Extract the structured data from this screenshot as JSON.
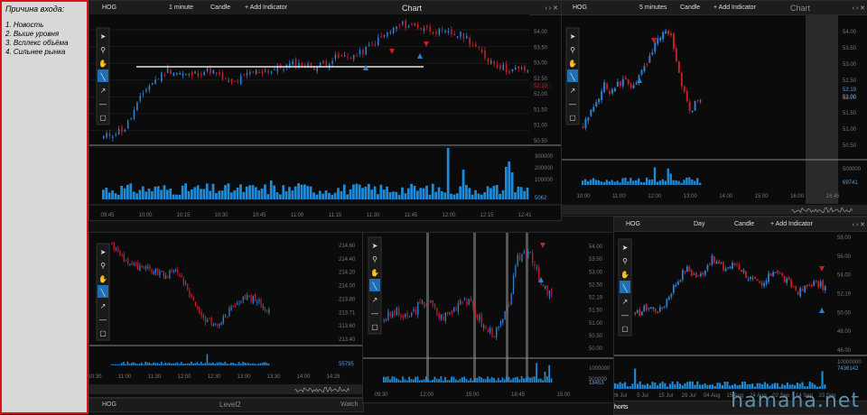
{
  "note": {
    "title": "Причина входа:",
    "items": [
      "1. Новость",
      "2. Выше уровня",
      "3. Всплекс объёма",
      "4. Сильнее рынка"
    ]
  },
  "colors": {
    "up": "#2f7fd0",
    "down": "#c0202a",
    "level": "#e8e8e8",
    "volume": "#1e8ad8",
    "axis": "#777777",
    "grid": "#1b1b1b"
  },
  "icons": {
    "tools": [
      "cursor-icon",
      "zoom-icon",
      "hand-icon",
      "line-icon",
      "arrow-icon",
      "hline-icon",
      "rect-icon"
    ],
    "window": [
      "left-arrow-icon",
      "right-arrow-icon",
      "close-icon"
    ]
  },
  "main": {
    "symbol": "HOG",
    "interval": "1 minute",
    "type": "Candle",
    "add": "+ Add Indicator",
    "title": "Chart",
    "y_labels": [
      "54.00",
      "53.50",
      "53.00",
      "52.50",
      "52.00",
      "51.50",
      "51.00",
      "50.50"
    ],
    "price_tag": "52.19",
    "vol_labels": [
      "300000",
      "200000",
      "100000"
    ],
    "vol_tag": "5062",
    "x_labels": [
      "09:45",
      "10:00",
      "10:15",
      "10:30",
      "10:45",
      "11:00",
      "11:15",
      "11:30",
      "11:45",
      "12:00",
      "12:15",
      "12:41"
    ]
  },
  "tr": {
    "symbol": "HOG",
    "interval": "5 minutes",
    "type": "Candle",
    "add": "+ Add Indicator",
    "title": "Chart",
    "y_labels": [
      "54.00",
      "53.50",
      "53.00",
      "52.50",
      "52.00",
      "51.50",
      "51.00",
      "50.50"
    ],
    "price_tags": [
      "52.19",
      "52.00"
    ],
    "vol_labels": [
      "500000"
    ],
    "vol_tag": "69741",
    "x_labels": [
      "10:00",
      "11:00",
      "12:00",
      "13:00",
      "14:00",
      "15:00",
      "16:00",
      "16:45"
    ]
  },
  "bl": {
    "y_labels": [
      "214.60",
      "214.40",
      "214.20",
      "214.00",
      "213.80",
      "213.71",
      "213.60",
      "213.40"
    ],
    "vol_tag": "55795",
    "x_labels": [
      "10:30",
      "11:00",
      "11:30",
      "12:00",
      "12:30",
      "13:00",
      "13:30",
      "14:00",
      "14:28"
    ],
    "footer": {
      "symbol": "HOG",
      "title": "Level2",
      "next": "Watch"
    }
  },
  "bm": {
    "y_labels": [
      "54.00",
      "53.50",
      "53.00",
      "52.50",
      "52.19",
      "51.50",
      "51.00",
      "50.50",
      "50.00"
    ],
    "vol_labels": [
      "1000000",
      "500000"
    ],
    "vol_tag": "18453",
    "x_labels": [
      "09:30",
      "12:00",
      "15:00",
      "18:45",
      "15:00"
    ]
  },
  "br": {
    "symbol": "HOG",
    "interval": "Day",
    "type": "Candle",
    "add": "+ Add Indicator",
    "y_labels": [
      "58.00",
      "56.00",
      "54.00",
      "52.19",
      "50.00",
      "48.00",
      "46.00"
    ],
    "vol_labels": [
      "10000000"
    ],
    "vol_tag": "7436142",
    "x_labels": [
      "26 Jul",
      "5 Jul",
      "15 Jul",
      "28 Jul",
      "04 Aug",
      "15 Aug",
      "24 Aug",
      "02 Sep",
      "14 Sep",
      "23 Sep"
    ],
    "footer": "horts"
  },
  "watermark": "hamaha.net"
}
